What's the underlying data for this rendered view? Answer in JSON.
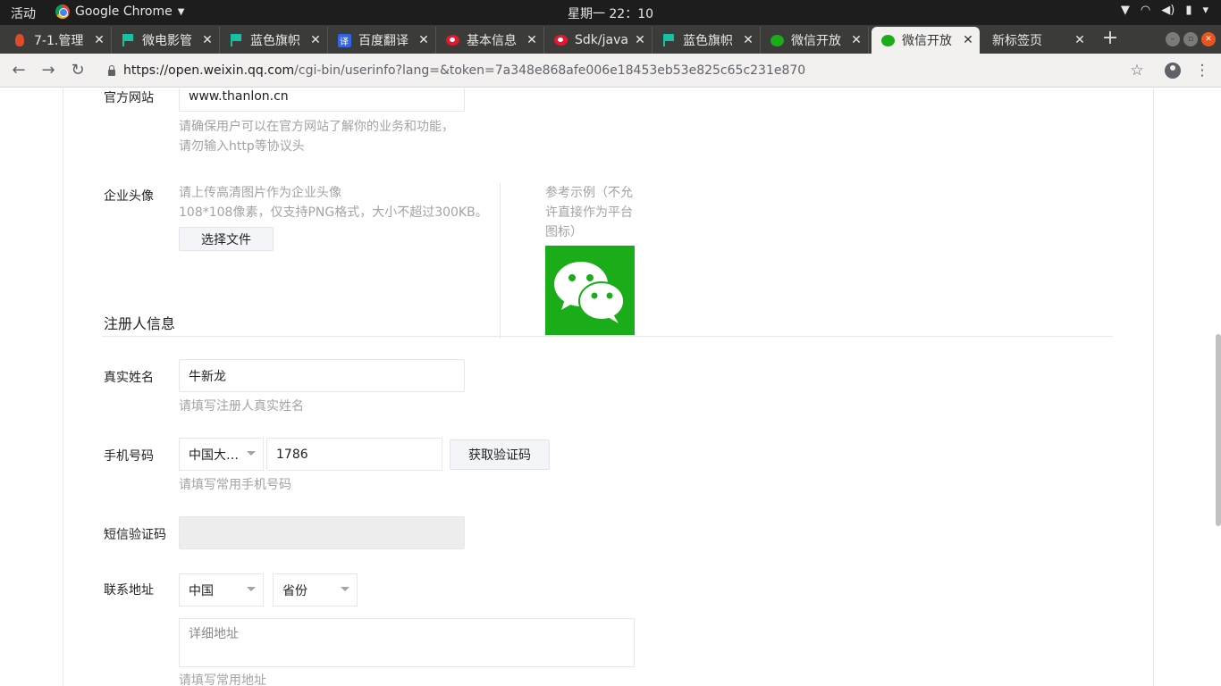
{
  "os_bar": {
    "activities": "活动",
    "app_name": "Google Chrome",
    "clock": "星期一 22：10"
  },
  "tabs": [
    {
      "title": "7-1.管理",
      "icon": "fire-icon"
    },
    {
      "title": "微电影管",
      "icon": "flag-icon"
    },
    {
      "title": "蓝色旗帜",
      "icon": "flag-icon"
    },
    {
      "title": "百度翻译",
      "icon": "fanyi-icon",
      "icon_text": "译"
    },
    {
      "title": "基本信息",
      "icon": "weibo-icon"
    },
    {
      "title": "Sdk/java",
      "icon": "weibo-icon"
    },
    {
      "title": "蓝色旗帜",
      "icon": "flag-icon"
    },
    {
      "title": "微信开放",
      "icon": "wechat-icon"
    },
    {
      "title": "微信开放",
      "icon": "wechat-icon",
      "active": true
    },
    {
      "title": "新标签页",
      "icon": ""
    }
  ],
  "omnibox": {
    "host": "https://open.weixin.qq.com",
    "path": "/cgi-bin/userinfo?lang=&token=7a348e868afe006e18453eb53e825c65c231e870"
  },
  "form": {
    "website": {
      "label": "官方网站",
      "value": "www.thanlon.cn",
      "hint_line1": "请确保用户可以在官方网站了解你的业务和功能，",
      "hint_line2": "请勿输入http等协议头"
    },
    "avatar": {
      "label": "企业头像",
      "hint_line1": "请上传高清图片作为企业头像",
      "hint_line2": "108*108像素，仅支持PNG格式，大小不超过300KB。",
      "choose_button": "选择文件",
      "sample_line1": "参考示例（不允",
      "sample_line2": "许直接作为平台",
      "sample_line3": "图标）"
    },
    "registrant_section": "注册人信息",
    "real_name": {
      "label": "真实姓名",
      "value": "牛新龙",
      "hint": "请填写注册人真实姓名"
    },
    "phone": {
      "label": "手机号码",
      "country": "中国大…",
      "value": "1786",
      "get_code_button": "获取验证码",
      "hint": "请填写常用手机号码"
    },
    "sms_code": {
      "label": "短信验证码",
      "value": ""
    },
    "address": {
      "label": "联系地址",
      "country": "中国",
      "province": "省份",
      "detail_placeholder": "详细地址",
      "hint": "请填写常用地址"
    }
  },
  "colors": {
    "wechat_green": "#1aad19",
    "tab_strip": "#3b3b39",
    "hint_gray": "#a3a3a3"
  }
}
